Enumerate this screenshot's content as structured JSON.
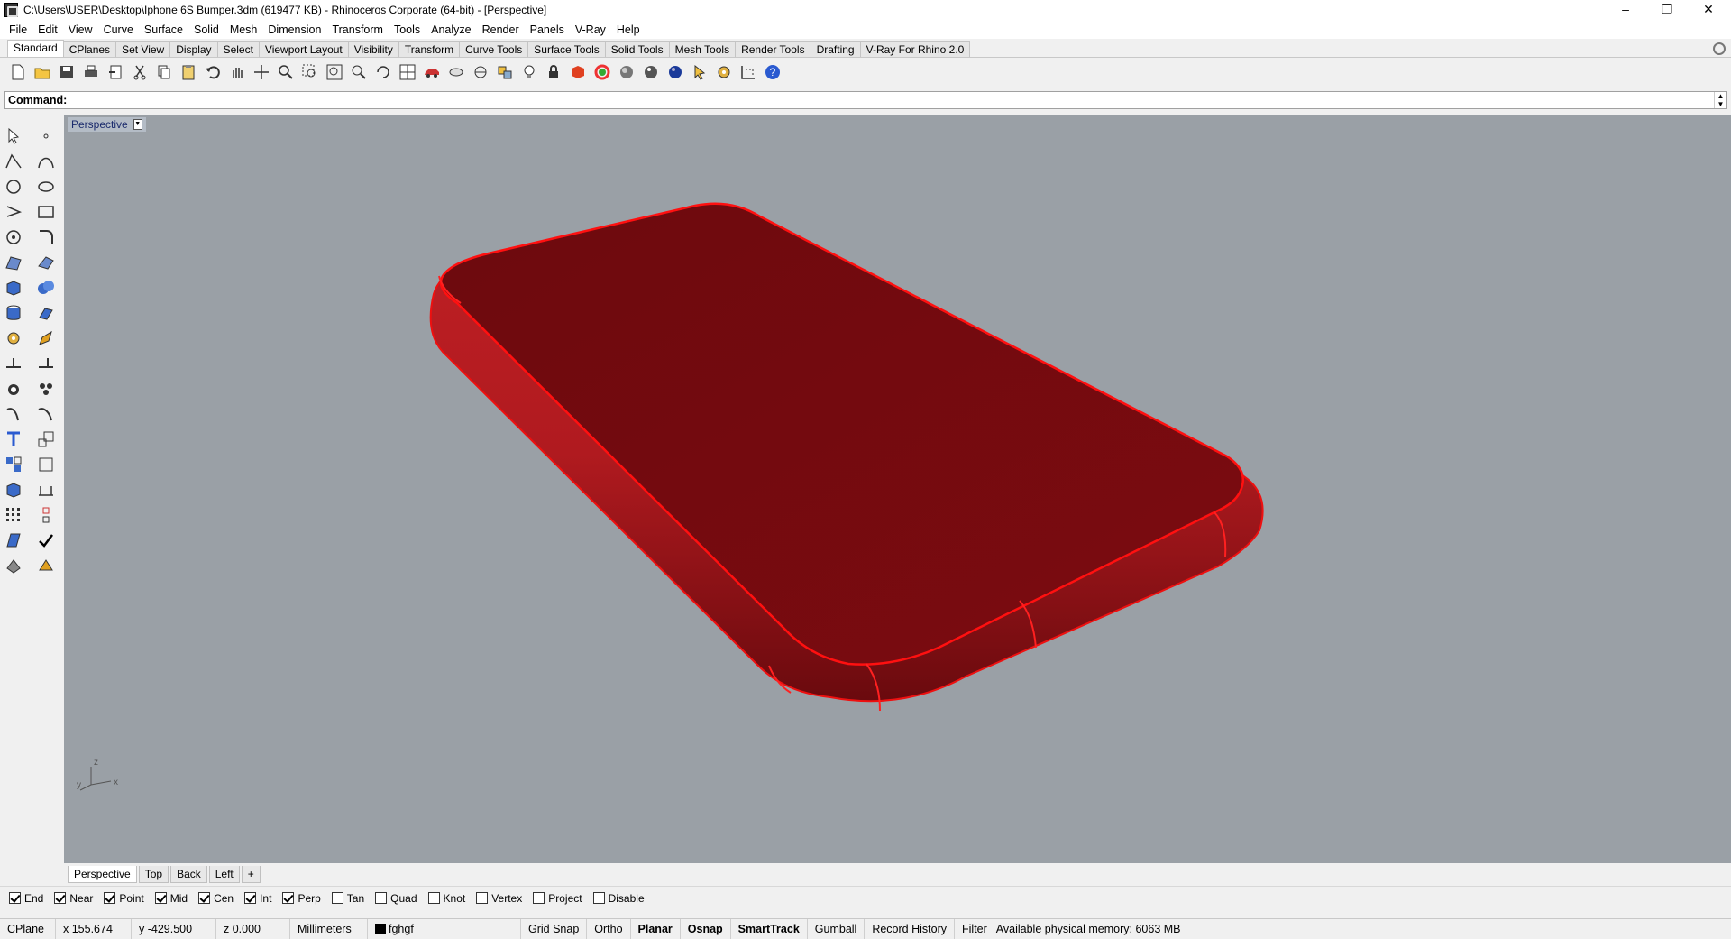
{
  "window": {
    "title": "C:\\Users\\USER\\Desktop\\Iphone 6S Bumper.3dm (619477 KB) - Rhinoceros Corporate (64-bit) - [Perspective]",
    "minimize": "–",
    "restore": "❐",
    "close": "✕"
  },
  "menu": [
    "File",
    "Edit",
    "View",
    "Curve",
    "Surface",
    "Solid",
    "Mesh",
    "Dimension",
    "Transform",
    "Tools",
    "Analyze",
    "Render",
    "Panels",
    "V-Ray",
    "Help"
  ],
  "toolbar_tabs": [
    "Standard",
    "CPlanes",
    "Set View",
    "Display",
    "Select",
    "Viewport Layout",
    "Visibility",
    "Transform",
    "Curve Tools",
    "Surface Tools",
    "Solid Tools",
    "Mesh Tools",
    "Render Tools",
    "Drafting",
    "V-Ray For Rhino 2.0"
  ],
  "toolbar_icons": [
    "new-icon",
    "open-icon",
    "save-icon",
    "print-icon",
    "import-icon",
    "cut-icon",
    "copy-icon",
    "paste-icon",
    "undo-icon",
    "pan-icon",
    "move-view-icon",
    "zoom-icon",
    "zoom-window-icon",
    "zoom-extents-icon",
    "zoom-selected-icon",
    "rotate-view-icon",
    "viewport-layout-icon",
    "car-icon",
    "lens-icon",
    "target-icon",
    "properties-icon",
    "light-icon",
    "lock-icon",
    "material-icon",
    "color-icon",
    "shaded-icon",
    "rendered-icon",
    "render-icon",
    "pointer-icon",
    "settings-icon",
    "dimension-icon",
    "help-icon"
  ],
  "command": {
    "label": "Command:"
  },
  "viewport": {
    "name": "Perspective",
    "background": "#9aa0a6",
    "axis_z": "z",
    "axis_y": "y",
    "axis_x": "x",
    "object_color": "#7a0a0e"
  },
  "view_tabs": [
    "Perspective",
    "Top",
    "Back",
    "Left"
  ],
  "view_tab_add": "+",
  "osnaps": [
    {
      "label": "End",
      "checked": true
    },
    {
      "label": "Near",
      "checked": true
    },
    {
      "label": "Point",
      "checked": true
    },
    {
      "label": "Mid",
      "checked": true
    },
    {
      "label": "Cen",
      "checked": true
    },
    {
      "label": "Int",
      "checked": true
    },
    {
      "label": "Perp",
      "checked": true
    },
    {
      "label": "Tan",
      "checked": false
    },
    {
      "label": "Quad",
      "checked": false
    },
    {
      "label": "Knot",
      "checked": false
    },
    {
      "label": "Vertex",
      "checked": false
    },
    {
      "label": "Project",
      "checked": false
    },
    {
      "label": "Disable",
      "checked": false
    }
  ],
  "status": {
    "cplane": "CPlane",
    "x": "x 155.674",
    "y": "y -429.500",
    "z": "z 0.000",
    "units": "Millimeters",
    "layer": "fghgf",
    "grid_snap": "Grid Snap",
    "ortho": "Ortho",
    "planar": "Planar",
    "osnap": "Osnap",
    "smarttrack": "SmartTrack",
    "gumball": "Gumball",
    "record_history": "Record History",
    "filter": "Filter",
    "memory": "Available physical memory: 6063 MB"
  }
}
